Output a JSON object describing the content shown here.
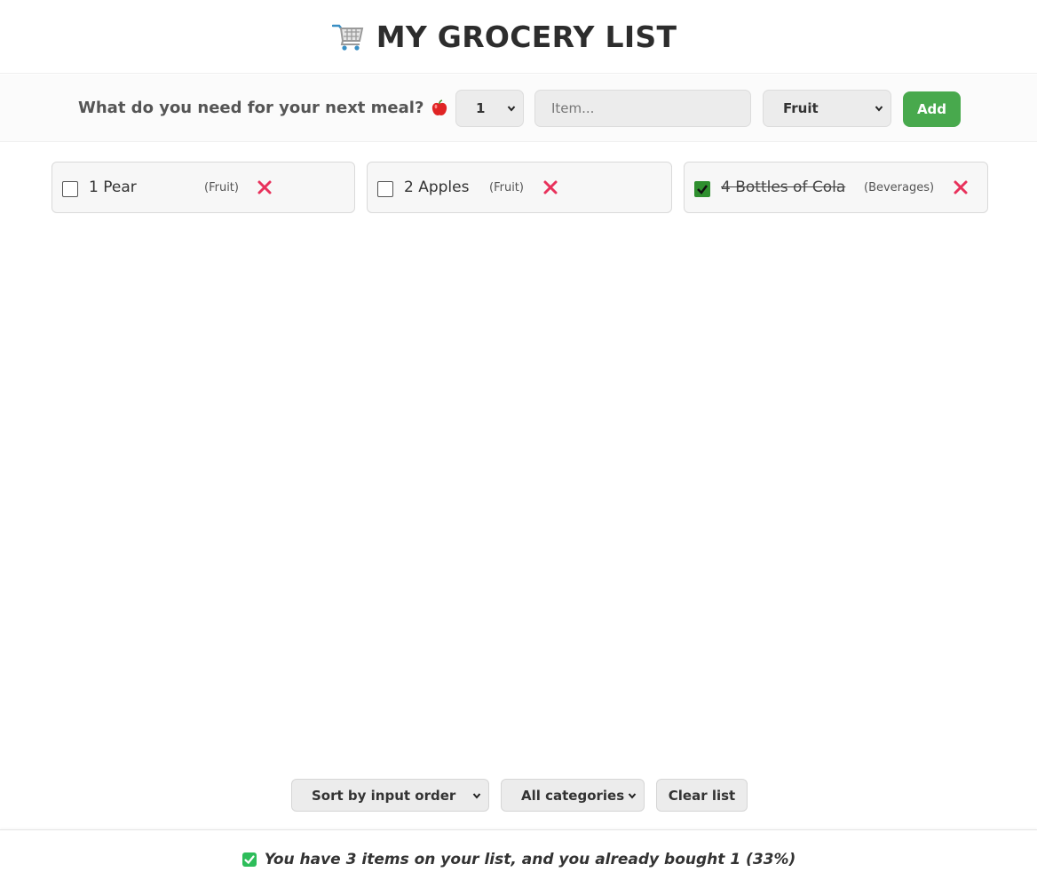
{
  "header": {
    "title": "MY GROCERY LIST",
    "icon": "shopping-cart-icon"
  },
  "form": {
    "question": "What do you need for your next meal?",
    "question_icon": "apple-icon",
    "quantity_selected": "1",
    "item_placeholder": "Item...",
    "category_selected": "Fruit",
    "add_label": "Add"
  },
  "items": [
    {
      "name": "1 Pear",
      "category": "(Fruit)",
      "bought": false
    },
    {
      "name": "2 Apples",
      "category": "(Fruit)",
      "bought": false
    },
    {
      "name": "4 Bottles of Cola",
      "category": "(Beverages)",
      "bought": true
    }
  ],
  "controls": {
    "sort_selected": "Sort by input order",
    "filter_selected": "All categories",
    "clear_label": "Clear list"
  },
  "footer": {
    "stats_text": "You have 3 items on your list, and you already bought 1 (33%)",
    "stats_icon": "check-icon"
  },
  "colors": {
    "accent_green": "#48a94d",
    "delete_red": "#e8315b",
    "checkbox_green": "#2f8f2f"
  }
}
